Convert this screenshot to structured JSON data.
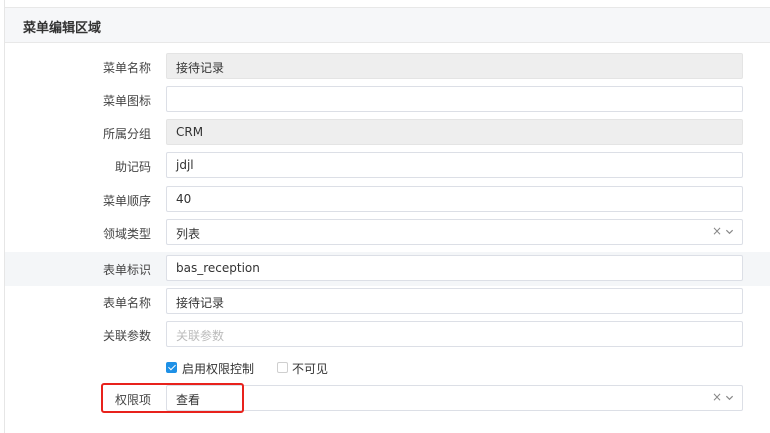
{
  "section": {
    "title": "菜单编辑区域"
  },
  "fields": {
    "menu_name": {
      "label": "菜单名称",
      "value": "接待记录"
    },
    "menu_icon": {
      "label": "菜单图标",
      "value": ""
    },
    "group": {
      "label": "所属分组",
      "value": "CRM"
    },
    "mnemonic": {
      "label": "助记码",
      "value": "jdjl"
    },
    "order": {
      "label": "菜单顺序",
      "value": "40"
    },
    "domain_type": {
      "label": "领域类型",
      "value": "列表"
    },
    "form_id": {
      "label": "表单标识",
      "value": "bas_reception"
    },
    "form_name": {
      "label": "表单名称",
      "value": "接待记录"
    },
    "params": {
      "label": "关联参数",
      "placeholder": "关联参数"
    },
    "permission": {
      "label": "权限项",
      "value": "查看"
    }
  },
  "checkboxes": {
    "enable_permission": {
      "label": "启用权限控制",
      "checked": true
    },
    "invisible": {
      "label": "不可见",
      "checked": false
    }
  },
  "icons": {
    "clear": "×",
    "dropdown": "chevron-down-icon"
  },
  "colors": {
    "accent": "#1e90e6",
    "highlight_box": "#e8221c"
  }
}
